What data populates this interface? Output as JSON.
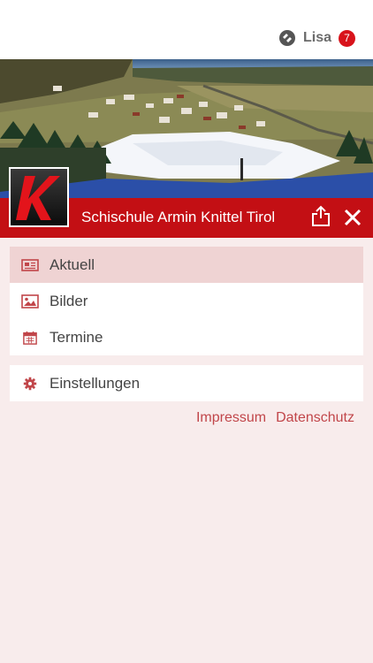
{
  "header": {
    "username": "Lisa",
    "notification_count": "7"
  },
  "title_bar": {
    "title": "Schischule Armin Knittel Tirol",
    "logo_letter": "K"
  },
  "menu": {
    "items": [
      {
        "label": "Aktuell",
        "icon": "newspaper-icon",
        "active": true
      },
      {
        "label": "Bilder",
        "icon": "image-icon",
        "active": false
      },
      {
        "label": "Termine",
        "icon": "calendar-icon",
        "active": false
      }
    ],
    "settings": {
      "label": "Einstellungen",
      "icon": "gear-icon"
    }
  },
  "footer": {
    "impressum": "Impressum",
    "datenschutz": "Datenschutz"
  },
  "colors": {
    "brand_red": "#c30f14",
    "accent": "#c1464a",
    "background": "#f8ecec",
    "active_item": "#efd3d3"
  }
}
